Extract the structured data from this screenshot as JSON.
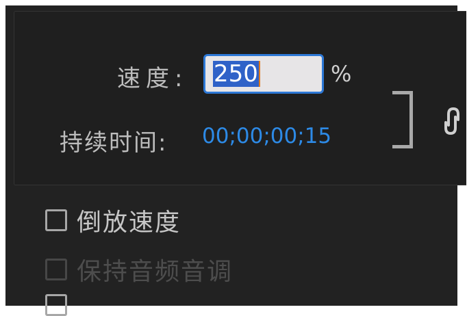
{
  "speed": {
    "label": "速度:",
    "value": "250",
    "unit": "%"
  },
  "duration": {
    "label": "持续时间:",
    "value": "00;00;00;15"
  },
  "link_toggle": {
    "icon": "chain-link-icon",
    "state": "linked"
  },
  "options": {
    "reverse_speed": {
      "label": "倒放速度",
      "checked": false,
      "enabled": true
    },
    "maintain_audio_pitch": {
      "label": "保持音频音调",
      "checked": false,
      "enabled": false
    }
  },
  "colors": {
    "background": "#222222",
    "accent": "#2d78d6",
    "timecode": "#2d8ae6",
    "label": "#bdbdbd",
    "disabled": "#4d4d4d"
  }
}
